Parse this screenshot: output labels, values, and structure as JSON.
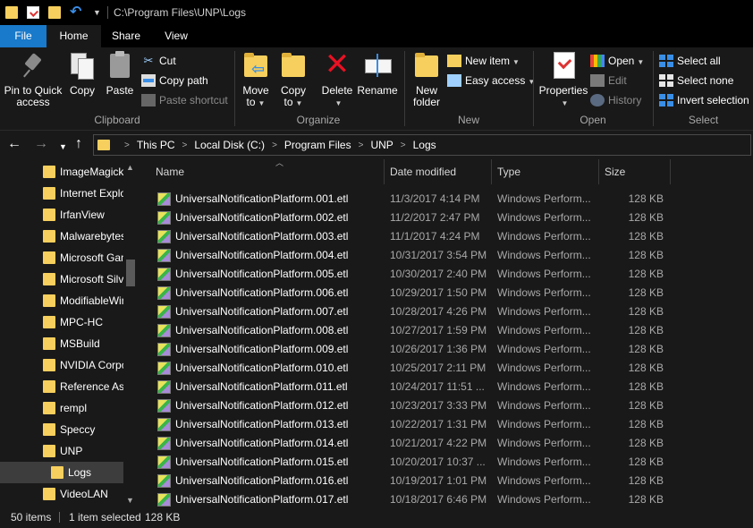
{
  "window": {
    "title": "C:\\Program Files\\UNP\\Logs"
  },
  "tabs": {
    "file": "File",
    "home": "Home",
    "share": "Share",
    "view": "View"
  },
  "ribbon": {
    "clipboard": {
      "label": "Clipboard",
      "pin_line1": "Pin to Quick",
      "pin_line2": "access",
      "copy": "Copy",
      "paste": "Paste",
      "cut": "Cut",
      "copy_path": "Copy path",
      "paste_shortcut": "Paste shortcut"
    },
    "organize": {
      "label": "Organize",
      "move_to_line1": "Move",
      "move_to_line2": "to",
      "copy_to_line1": "Copy",
      "copy_to_line2": "to",
      "delete": "Delete",
      "rename": "Rename"
    },
    "new": {
      "label": "New",
      "new_folder_line1": "New",
      "new_folder_line2": "folder",
      "new_item": "New item",
      "easy_access": "Easy access"
    },
    "open": {
      "label": "Open",
      "properties": "Properties",
      "open": "Open",
      "edit": "Edit",
      "history": "History"
    },
    "select": {
      "label": "Select",
      "select_all": "Select all",
      "select_none": "Select none",
      "invert": "Invert selection"
    }
  },
  "address": {
    "crumbs": [
      "This PC",
      "Local Disk (C:)",
      "Program Files",
      "UNP",
      "Logs"
    ]
  },
  "nav_items": [
    "ImageMagick",
    "Internet Explorer",
    "IrfanView",
    "Malwarebytes",
    "Microsoft Games",
    "Microsoft Silverlight",
    "ModifiableWindowsApps",
    "MPC-HC",
    "MSBuild",
    "NVIDIA Corporation",
    "Reference Assemblies",
    "rempl",
    "Speccy",
    "UNP",
    "Logs",
    "VideoLAN"
  ],
  "columns": {
    "name": "Name",
    "date": "Date modified",
    "type": "Type",
    "size": "Size"
  },
  "files": [
    {
      "name": "UniversalNotificationPlatform.001.etl",
      "date": "11/3/2017 4:14 PM",
      "type": "Windows Perform...",
      "size": "128 KB"
    },
    {
      "name": "UniversalNotificationPlatform.002.etl",
      "date": "11/2/2017 2:47 PM",
      "type": "Windows Perform...",
      "size": "128 KB"
    },
    {
      "name": "UniversalNotificationPlatform.003.etl",
      "date": "11/1/2017 4:24 PM",
      "type": "Windows Perform...",
      "size": "128 KB"
    },
    {
      "name": "UniversalNotificationPlatform.004.etl",
      "date": "10/31/2017 3:54 PM",
      "type": "Windows Perform...",
      "size": "128 KB"
    },
    {
      "name": "UniversalNotificationPlatform.005.etl",
      "date": "10/30/2017 2:40 PM",
      "type": "Windows Perform...",
      "size": "128 KB"
    },
    {
      "name": "UniversalNotificationPlatform.006.etl",
      "date": "10/29/2017 1:50 PM",
      "type": "Windows Perform...",
      "size": "128 KB"
    },
    {
      "name": "UniversalNotificationPlatform.007.etl",
      "date": "10/28/2017 4:26 PM",
      "type": "Windows Perform...",
      "size": "128 KB"
    },
    {
      "name": "UniversalNotificationPlatform.008.etl",
      "date": "10/27/2017 1:59 PM",
      "type": "Windows Perform...",
      "size": "128 KB"
    },
    {
      "name": "UniversalNotificationPlatform.009.etl",
      "date": "10/26/2017 1:36 PM",
      "type": "Windows Perform...",
      "size": "128 KB"
    },
    {
      "name": "UniversalNotificationPlatform.010.etl",
      "date": "10/25/2017 2:11 PM",
      "type": "Windows Perform...",
      "size": "128 KB"
    },
    {
      "name": "UniversalNotificationPlatform.011.etl",
      "date": "10/24/2017 11:51 ...",
      "type": "Windows Perform...",
      "size": "128 KB"
    },
    {
      "name": "UniversalNotificationPlatform.012.etl",
      "date": "10/23/2017 3:33 PM",
      "type": "Windows Perform...",
      "size": "128 KB"
    },
    {
      "name": "UniversalNotificationPlatform.013.etl",
      "date": "10/22/2017 1:31 PM",
      "type": "Windows Perform...",
      "size": "128 KB"
    },
    {
      "name": "UniversalNotificationPlatform.014.etl",
      "date": "10/21/2017 4:22 PM",
      "type": "Windows Perform...",
      "size": "128 KB"
    },
    {
      "name": "UniversalNotificationPlatform.015.etl",
      "date": "10/20/2017 10:37 ...",
      "type": "Windows Perform...",
      "size": "128 KB"
    },
    {
      "name": "UniversalNotificationPlatform.016.etl",
      "date": "10/19/2017 1:01 PM",
      "type": "Windows Perform...",
      "size": "128 KB"
    },
    {
      "name": "UniversalNotificationPlatform.017.etl",
      "date": "10/18/2017 6:46 PM",
      "type": "Windows Perform...",
      "size": "128 KB"
    }
  ],
  "status": {
    "items": "50 items",
    "selected": "1 item selected",
    "size": "128 KB"
  },
  "icons": {
    "file": "etl-file-icon",
    "folder": "folder-icon"
  },
  "colors": {
    "accent": "#1979ca",
    "background": "#191919",
    "folder": "#f6cf5e"
  }
}
